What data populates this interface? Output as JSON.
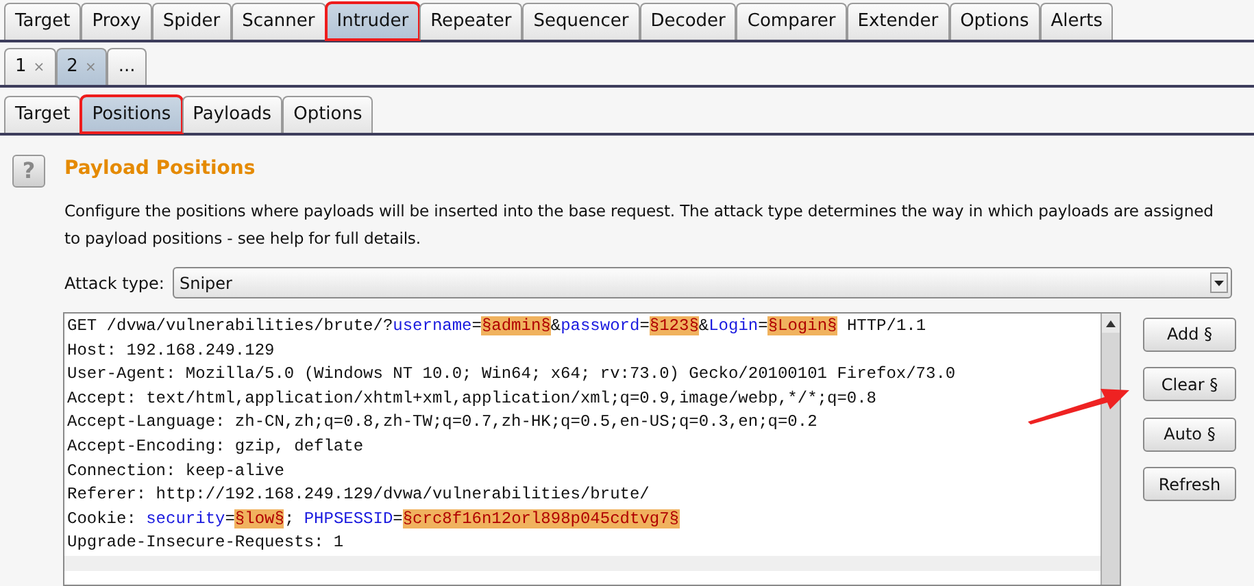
{
  "main_tabs": [
    {
      "label": "Target",
      "selected": false,
      "annotated": false
    },
    {
      "label": "Proxy",
      "selected": false,
      "annotated": false
    },
    {
      "label": "Spider",
      "selected": false,
      "annotated": false
    },
    {
      "label": "Scanner",
      "selected": false,
      "annotated": false
    },
    {
      "label": "Intruder",
      "selected": true,
      "annotated": true
    },
    {
      "label": "Repeater",
      "selected": false,
      "annotated": false
    },
    {
      "label": "Sequencer",
      "selected": false,
      "annotated": false
    },
    {
      "label": "Decoder",
      "selected": false,
      "annotated": false
    },
    {
      "label": "Comparer",
      "selected": false,
      "annotated": false
    },
    {
      "label": "Extender",
      "selected": false,
      "annotated": false
    },
    {
      "label": "Options",
      "selected": false,
      "annotated": false
    },
    {
      "label": "Alerts",
      "selected": false,
      "annotated": false
    }
  ],
  "attack_tabs": [
    {
      "label": "1",
      "close": "×",
      "selected": false
    },
    {
      "label": "2",
      "close": "×",
      "selected": true
    },
    {
      "label": "...",
      "selected": false
    }
  ],
  "sub_tabs": [
    {
      "label": "Target",
      "selected": false,
      "annotated": false
    },
    {
      "label": "Positions",
      "selected": true,
      "annotated": true
    },
    {
      "label": "Payloads",
      "selected": false,
      "annotated": false
    },
    {
      "label": "Options",
      "selected": false,
      "annotated": false
    }
  ],
  "help_icon": "?",
  "title": "Payload Positions",
  "description": "Configure the positions where payloads will be inserted into the base request. The attack type determines the way in which payloads are assigned to payload positions - see help for full details.",
  "attack_type": {
    "label": "Attack type:",
    "value": "Sniper"
  },
  "request_lines": [
    [
      {
        "kind": "plain",
        "text": "GET /dvwa/vulnerabilities/brute/?"
      },
      {
        "kind": "param",
        "text": "username"
      },
      {
        "kind": "plain",
        "text": "="
      },
      {
        "kind": "payload",
        "text": "§admin§"
      },
      {
        "kind": "plain",
        "text": "&"
      },
      {
        "kind": "param",
        "text": "password"
      },
      {
        "kind": "plain",
        "text": "="
      },
      {
        "kind": "payload",
        "text": "§123§"
      },
      {
        "kind": "plain",
        "text": "&"
      },
      {
        "kind": "param",
        "text": "Login"
      },
      {
        "kind": "plain",
        "text": "="
      },
      {
        "kind": "payload",
        "text": "§Login§"
      },
      {
        "kind": "plain",
        "text": " HTTP/1.1"
      }
    ],
    [
      {
        "kind": "plain",
        "text": "Host: 192.168.249.129"
      }
    ],
    [
      {
        "kind": "plain",
        "text": "User-Agent: Mozilla/5.0 (Windows NT 10.0; Win64; x64; rv:73.0) Gecko/20100101 Firefox/73.0"
      }
    ],
    [
      {
        "kind": "plain",
        "text": "Accept: text/html,application/xhtml+xml,application/xml;q=0.9,image/webp,*/*;q=0.8"
      }
    ],
    [
      {
        "kind": "plain",
        "text": "Accept-Language: zh-CN,zh;q=0.8,zh-TW;q=0.7,zh-HK;q=0.5,en-US;q=0.3,en;q=0.2"
      }
    ],
    [
      {
        "kind": "plain",
        "text": "Accept-Encoding: gzip, deflate"
      }
    ],
    [
      {
        "kind": "plain",
        "text": "Connection: keep-alive"
      }
    ],
    [
      {
        "kind": "plain",
        "text": "Referer: http://192.168.249.129/dvwa/vulnerabilities/brute/"
      }
    ],
    [
      {
        "kind": "plain",
        "text": "Cookie: "
      },
      {
        "kind": "param",
        "text": "security"
      },
      {
        "kind": "plain",
        "text": "="
      },
      {
        "kind": "payload",
        "text": "§low§"
      },
      {
        "kind": "plain",
        "text": "; "
      },
      {
        "kind": "param",
        "text": "PHPSESSID"
      },
      {
        "kind": "plain",
        "text": "="
      },
      {
        "kind": "payload",
        "text": "§crc8f16n12orl898p045cdtvg7§"
      }
    ],
    [
      {
        "kind": "plain",
        "text": "Upgrade-Insecure-Requests: 1"
      }
    ]
  ],
  "buttons": [
    {
      "label": "Add §"
    },
    {
      "label": "Clear §"
    },
    {
      "label": "Auto §"
    },
    {
      "label": "Refresh"
    }
  ]
}
